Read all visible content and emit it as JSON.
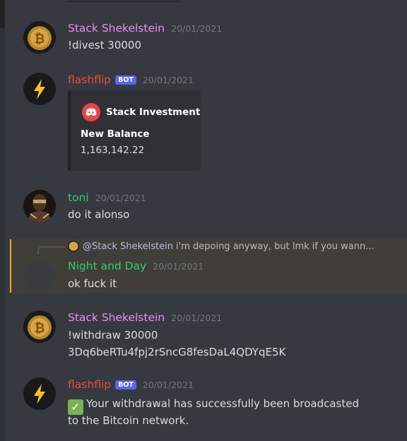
{
  "colors": {
    "stack_name": "#e88ff0",
    "flashflip_name": "#e74c3c",
    "toni_name": "#2ecc71",
    "nightday_name": "#2ecc71",
    "bot_tag_bg": "#5865f2",
    "highlight_border": "#faa61a"
  },
  "messages": [
    {
      "author": "Stack Shekelstein",
      "timestamp": "20/01/2021",
      "lines": [
        "!divest 30000"
      ],
      "avatar_icon": "bitcoin-coin-avatar-icon"
    },
    {
      "author": "flashflip",
      "bot_tag": "BOT",
      "timestamp": "20/01/2021",
      "avatar_icon": "lightning-bolt-avatar-icon",
      "embed": {
        "author_name": "Stack Investment",
        "author_icon": "discord-logo-icon",
        "field_name": "New Balance",
        "field_value": "1,163,142.22"
      }
    },
    {
      "author": "toni",
      "timestamp": "20/01/2021",
      "lines": [
        "do it alonso"
      ],
      "avatar_icon": "photo-avatar-icon"
    },
    {
      "author": "Night and Day",
      "timestamp": "20/01/2021",
      "lines": [
        "ok fuck it"
      ],
      "reply": {
        "mention": "@Stack Shekelstein",
        "text": "i'm depoing anyway, but lmk if you wann..."
      }
    },
    {
      "author": "Stack Shekelstein",
      "timestamp": "20/01/2021",
      "lines": [
        "!withdraw 30000",
        "3Dq6beRTu4fpj2rSncG8fesDaL4QDYqE5K"
      ],
      "avatar_icon": "bitcoin-coin-avatar-icon"
    },
    {
      "author": "flashflip",
      "bot_tag": "BOT",
      "timestamp": "20/01/2021",
      "lines": [
        "Your withdrawal has successfully been broadcasted",
        "to the Bitcoin network."
      ],
      "avatar_icon": "lightning-bolt-avatar-icon",
      "emoji": "white-check-mark-icon"
    }
  ]
}
